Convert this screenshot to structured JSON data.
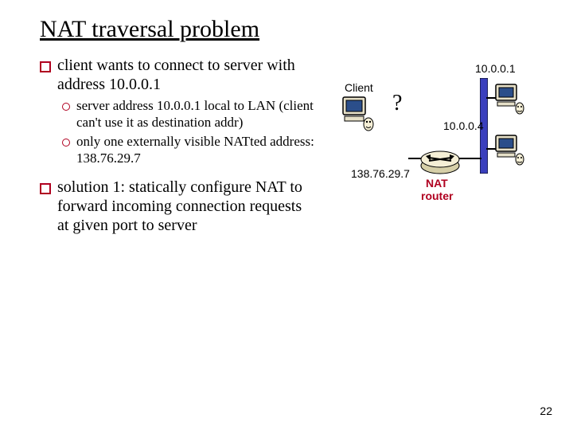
{
  "title": "NAT traversal problem",
  "bullets": {
    "intro": "client wants to connect to server with address 10.0.0.1",
    "sub1": "server address 10.0.0.1 local to LAN (client can't use it as destination addr)",
    "sub2": "only one externally visible NATted address: 138.76.29.7",
    "solution": "solution 1: statically configure NAT to forward incoming connection requests at given port to server"
  },
  "diagram": {
    "client_label": "Client",
    "question": "?",
    "public_ip": "138.76.29.7",
    "router_label1": "NAT",
    "router_label2": "router",
    "server_ip": "10.0.0.1",
    "lan_ip": "10.0.0.4"
  },
  "page_number": "22"
}
